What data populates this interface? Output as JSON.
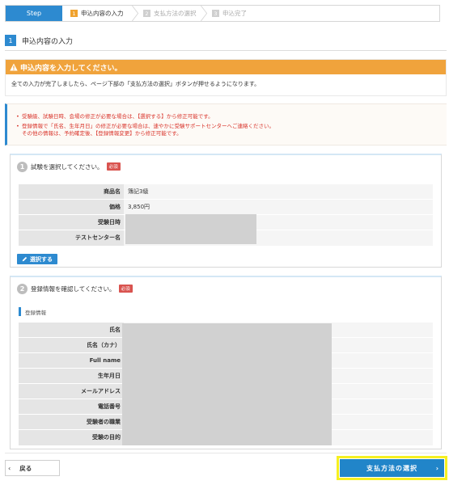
{
  "stepbar": {
    "label": "Step",
    "steps": [
      {
        "num": "1",
        "label": "申込内容の入力"
      },
      {
        "num": "2",
        "label": "支払方法の選択"
      },
      {
        "num": "3",
        "label": "申込完了"
      }
    ]
  },
  "section": {
    "num": "1",
    "title": "申込内容の入力"
  },
  "warning": {
    "title": "申込内容を入力してください。",
    "text": "全ての入力が完了しましたら、ページ下部の「支払方法の選択」ボタンが押せるようになります。"
  },
  "notice": {
    "line1": "受験級、試験日時、会場の修正が必要な場合は、【選択する】から修正可能です。",
    "line2": "登録情報で「氏名、生年月日」の修正が必要な場合は、速やかに受験サポートセンターへご連絡ください。",
    "line3": "その他の情報は、予約確定後、【登録情報変更】から修正可能です。"
  },
  "card1": {
    "num": "1",
    "title": "試験を選択してください。",
    "required": "必須",
    "rows": [
      {
        "key": "商品名",
        "value": "簿記3級"
      },
      {
        "key": "価格",
        "value": "3,850円"
      },
      {
        "key": "受験日時",
        "value": ""
      },
      {
        "key": "テストセンター名",
        "value": ""
      }
    ],
    "select_label": "選択する"
  },
  "card2": {
    "num": "2",
    "title": "登録情報を確認してください。",
    "required": "必須",
    "subhead": "登録情報",
    "rows": [
      {
        "key": "氏名"
      },
      {
        "key": "氏名（カナ）"
      },
      {
        "key": "Full name"
      },
      {
        "key": "生年月日"
      },
      {
        "key": "メールアドレス"
      },
      {
        "key": "電話番号"
      },
      {
        "key": "受験者の職業"
      },
      {
        "key": "受験の目的"
      }
    ]
  },
  "footer": {
    "back_label": "戻る",
    "pay_label": "支払方法の選択"
  },
  "colors": {
    "accent": "#2d8ad0",
    "warning": "#f0a33c",
    "notice_text": "#d9342b",
    "highlight": "#f6f021"
  }
}
